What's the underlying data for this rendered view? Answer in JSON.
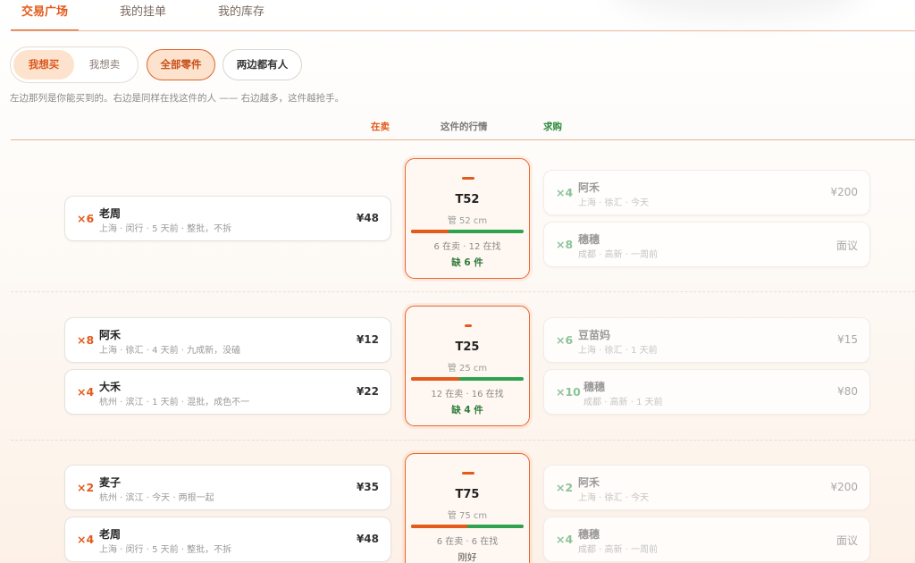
{
  "tabs": [
    "交易广场",
    "我的挂单",
    "我的库存"
  ],
  "filters": {
    "mode": [
      "我想买",
      "我想卖"
    ],
    "scope_all": "全部零件",
    "scope_both": "两边都有人"
  },
  "hint": "左边那列是你能买到的。右边是同样在找这件的人 —— 右边越多，这件越抢手。",
  "columns": {
    "sell": "在卖",
    "market": "这件的行情",
    "buy": "求购"
  },
  "colors": {
    "accent": "#e35a1b",
    "buy": "#2ea24f"
  },
  "rows": [
    {
      "market": {
        "part": "T52",
        "size": "管 52 cm",
        "counts": "6 在卖 · 12 在找",
        "status": "缺 6 件",
        "sell_count": 6,
        "want_count": 12
      },
      "sellers": [
        {
          "qty": "×6",
          "name": "老周",
          "meta": "上海 · 闵行 · 5 天前 · 整批，不拆",
          "price": "¥48"
        }
      ],
      "buyers": [
        {
          "qty": "×4",
          "name": "阿禾",
          "meta": "上海 · 徐汇 · 今天",
          "price": "¥200"
        },
        {
          "qty": "×8",
          "name": "穗穗",
          "meta": "成都 · 高新 · 一周前",
          "price": "面议"
        }
      ]
    },
    {
      "market": {
        "part": "T25",
        "size": "管 25 cm",
        "counts": "12 在卖 · 16 在找",
        "status": "缺 4 件",
        "sell_count": 12,
        "want_count": 16
      },
      "sellers": [
        {
          "qty": "×8",
          "name": "阿禾",
          "meta": "上海 · 徐汇 · 4 天前 · 九成新，没磕",
          "price": "¥12"
        },
        {
          "qty": "×4",
          "name": "大禾",
          "meta": "杭州 · 滨江 · 1 天前 · 混批，成色不一",
          "price": "¥22"
        }
      ],
      "buyers": [
        {
          "qty": "×6",
          "name": "豆苗妈",
          "meta": "上海 · 徐汇 · 1 天前",
          "price": "¥15"
        },
        {
          "qty": "×10",
          "name": "穗穗",
          "meta": "成都 · 高新 · 1 天前",
          "price": "¥80"
        }
      ]
    },
    {
      "market": {
        "part": "T75",
        "size": "管 75 cm",
        "counts": "6 在卖 · 6 在找",
        "status": "刚好",
        "sell_count": 6,
        "want_count": 6
      },
      "sellers": [
        {
          "qty": "×2",
          "name": "麦子",
          "meta": "杭州 · 滨江 · 今天 · 两根一起",
          "price": "¥35"
        },
        {
          "qty": "×4",
          "name": "老周",
          "meta": "上海 · 闵行 · 5 天前 · 整批，不拆",
          "price": "¥48"
        }
      ],
      "buyers": [
        {
          "qty": "×2",
          "name": "阿禾",
          "meta": "上海 · 徐汇 · 今天",
          "price": "¥200"
        },
        {
          "qty": "×4",
          "name": "穗穗",
          "meta": "成都 · 高新 · 一周前",
          "price": "面议"
        }
      ]
    }
  ]
}
